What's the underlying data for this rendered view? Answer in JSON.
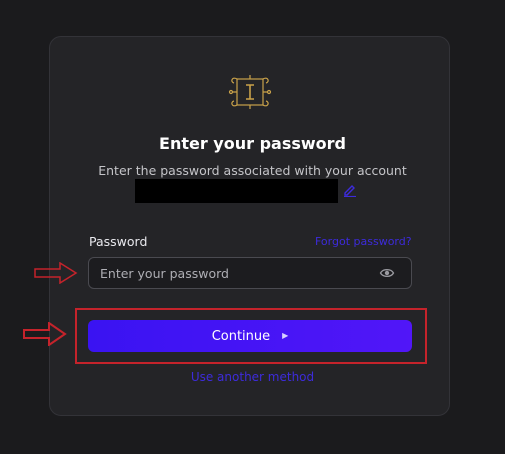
{
  "login": {
    "title": "Enter your password",
    "subtitle": "Enter the password associated with your account",
    "password_label": "Password",
    "forgot_link": "Forgot password?",
    "password_placeholder": "Enter your password",
    "continue_label": "Continue",
    "alt_method_link": "Use another method"
  },
  "icons": {
    "logo": "ornate-monogram-logo",
    "edit": "pencil-icon",
    "visibility": "eye-icon",
    "continue_glyph": "play-icon"
  },
  "colors": {
    "accent": "#4a14f5",
    "link": "#3d2bdb",
    "annotation": "#c5232b",
    "logo_gold": "#c9a24a"
  }
}
